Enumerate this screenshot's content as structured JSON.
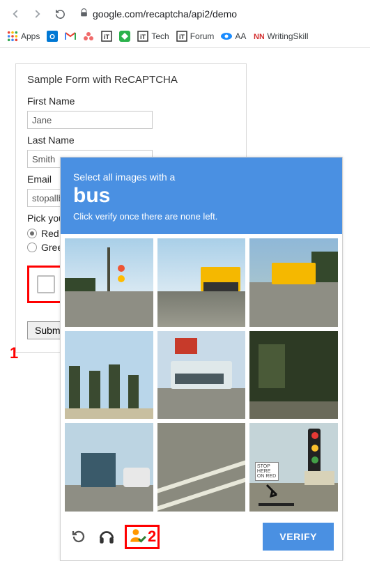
{
  "browser": {
    "url": "google.com/recaptcha/api2/demo",
    "bookmarks": [
      {
        "label": "Apps",
        "icon": "apps"
      },
      {
        "label": "",
        "icon": "outlook"
      },
      {
        "label": "",
        "icon": "gmail"
      },
      {
        "label": "",
        "icon": "asana"
      },
      {
        "label": "",
        "icon": "it"
      },
      {
        "label": "",
        "icon": "feedly"
      },
      {
        "label": "Tech",
        "icon": "it"
      },
      {
        "label": "Forum",
        "icon": "it"
      },
      {
        "label": "AA",
        "icon": "aa"
      },
      {
        "label": "WritingSkill",
        "icon": "nn"
      }
    ]
  },
  "form": {
    "title": "Sample Form with ReCAPTCHA",
    "first_name_label": "First Name",
    "first_name_value": "Jane",
    "last_name_label": "Last Name",
    "last_name_value": "Smith",
    "email_label": "Email",
    "email_value": "stopallbots@gmail.com",
    "color_label": "Pick your favorite color:",
    "option_red": "Red",
    "option_green": "Green",
    "submit_label": "Submit"
  },
  "annotations": {
    "one": "1",
    "two": "2"
  },
  "captcha": {
    "instruction_line1": "Select all images with a",
    "target": "bus",
    "instruction_line2": "Click verify once there are none left.",
    "verify_label": "VERIFY",
    "stop_sign": "STOP\nHERE ON\nRED"
  }
}
